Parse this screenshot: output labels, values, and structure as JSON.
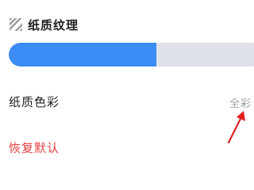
{
  "texture": {
    "title": "纸质纹理",
    "icon": "texture-pattern-icon",
    "slider_level": 0.58,
    "fill_color": "#3b8cf5",
    "track_color": "#dfe1e8"
  },
  "paper_color": {
    "label": "纸质色彩",
    "value": "全彩"
  },
  "reset": {
    "label": "恢复默认",
    "color": "#e7403f"
  },
  "annotation": {
    "icon": "red-arrow-icon",
    "color": "#e02020"
  }
}
